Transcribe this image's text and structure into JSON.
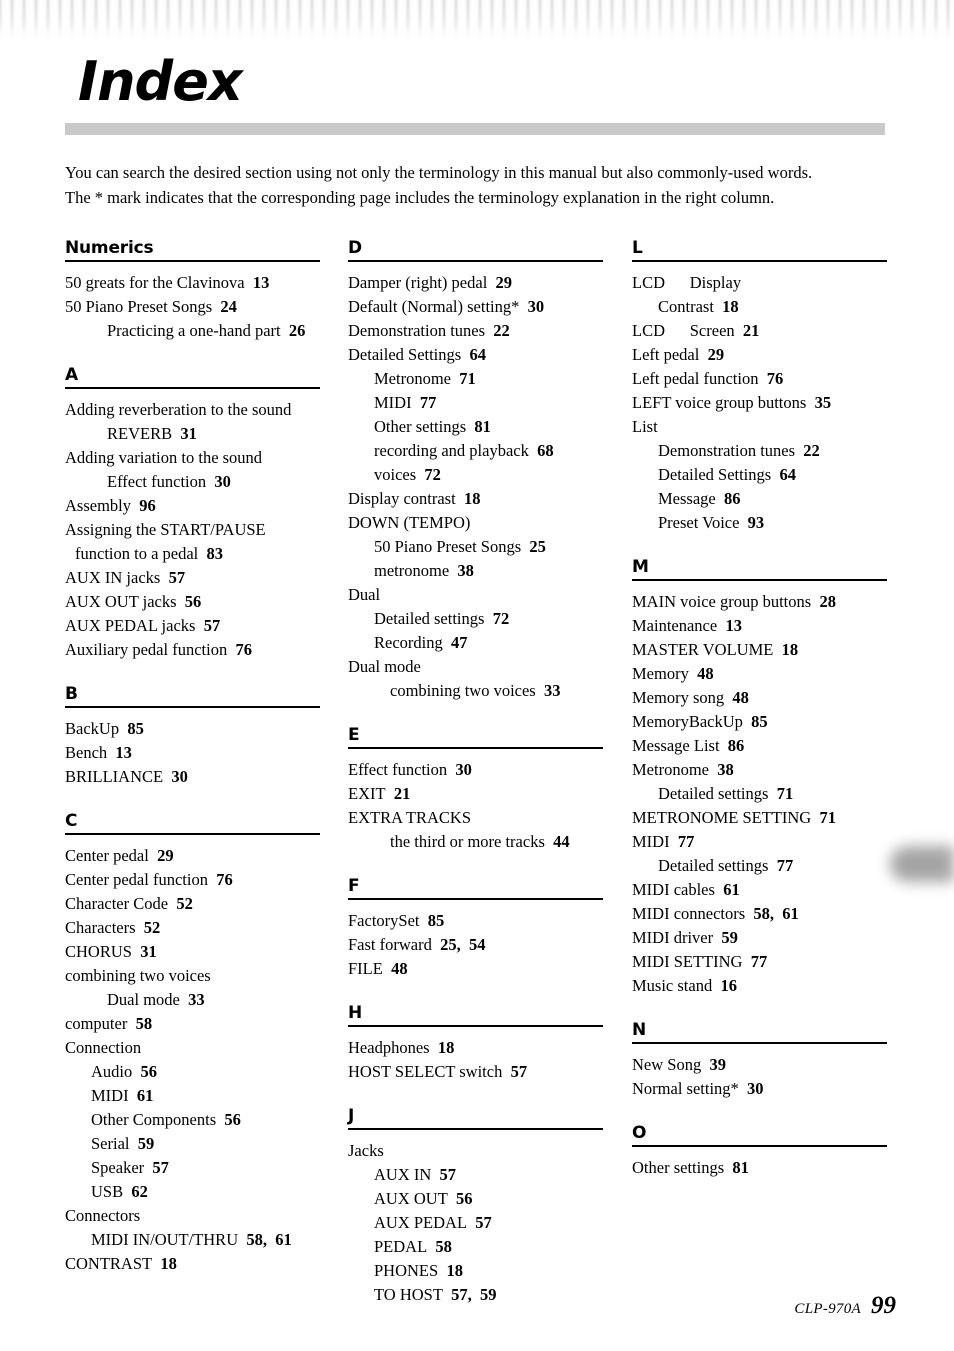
{
  "header": {
    "decoration": "piano-keyboard-band"
  },
  "title": "Index",
  "intro": {
    "line1": "You can search the desired section using not only the terminology in this manual but also commonly-used words.",
    "line2": "The * mark indicates that the corresponding page includes the terminology explanation in the right column."
  },
  "footer": {
    "model": "CLP-970A",
    "page": "99"
  },
  "columns": [
    {
      "id": "column-1",
      "sections": [
        {
          "heading": "Numerics",
          "entries": [
            {
              "level": 0,
              "text": "50 greats for the Clavinova",
              "page": "13"
            },
            {
              "level": 0,
              "text": "50 Piano Preset Songs",
              "page": "24"
            },
            {
              "level": 2,
              "text": "Practicing a one-hand part",
              "page": "26"
            }
          ]
        },
        {
          "heading": "A",
          "entries": [
            {
              "level": 0,
              "text": "Adding reverberation to the sound",
              "page": ""
            },
            {
              "level": 2,
              "text": "REVERB",
              "page": "31"
            },
            {
              "level": 0,
              "text": "Adding variation to the sound",
              "page": ""
            },
            {
              "level": 2,
              "text": "Effect function",
              "page": "30"
            },
            {
              "level": 0,
              "text": "Assembly",
              "page": "96"
            },
            {
              "level": 0,
              "text": "Assigning the START/PAUSE",
              "page": ""
            },
            {
              "level": 3,
              "text": "function to a pedal",
              "page": "83"
            },
            {
              "level": 0,
              "text": "AUX IN jacks",
              "page": "57"
            },
            {
              "level": 0,
              "text": "AUX OUT jacks",
              "page": "56"
            },
            {
              "level": 0,
              "text": "AUX PEDAL jacks",
              "page": "57"
            },
            {
              "level": 0,
              "text": "Auxiliary pedal function",
              "page": "76"
            }
          ]
        },
        {
          "heading": "B",
          "entries": [
            {
              "level": 0,
              "text": "BackUp",
              "page": "85"
            },
            {
              "level": 0,
              "text": "Bench",
              "page": "13"
            },
            {
              "level": 0,
              "text": "BRILLIANCE",
              "page": "30"
            }
          ]
        },
        {
          "heading": "C",
          "entries": [
            {
              "level": 0,
              "text": "Center pedal",
              "page": "29"
            },
            {
              "level": 0,
              "text": "Center pedal function",
              "page": "76"
            },
            {
              "level": 0,
              "text": "Character Code",
              "page": "52"
            },
            {
              "level": 0,
              "text": "Characters",
              "page": "52"
            },
            {
              "level": 0,
              "text": "CHORUS",
              "page": "31"
            },
            {
              "level": 0,
              "text": "combining two voices",
              "page": ""
            },
            {
              "level": 2,
              "text": "Dual mode",
              "page": "33"
            },
            {
              "level": 0,
              "text": "computer",
              "page": "58"
            },
            {
              "level": 0,
              "text": "Connection",
              "page": ""
            },
            {
              "level": 1,
              "text": "Audio",
              "page": "56"
            },
            {
              "level": 1,
              "text": "MIDI",
              "page": "61"
            },
            {
              "level": 1,
              "text": "Other Components",
              "page": "56"
            },
            {
              "level": 1,
              "text": "Serial",
              "page": "59"
            },
            {
              "level": 1,
              "text": "Speaker",
              "page": "57"
            },
            {
              "level": 1,
              "text": "USB",
              "page": "62"
            },
            {
              "level": 0,
              "text": "Connectors",
              "page": ""
            },
            {
              "level": 1,
              "text": "MIDI IN/OUT/THRU",
              "page": "58,  61"
            },
            {
              "level": 0,
              "text": "CONTRAST",
              "page": "18"
            }
          ]
        }
      ]
    },
    {
      "id": "column-2",
      "sections": [
        {
          "heading": "D",
          "entries": [
            {
              "level": 0,
              "text": "Damper (right) pedal",
              "page": "29"
            },
            {
              "level": 0,
              "text": "Default (Normal) setting*",
              "page": "30"
            },
            {
              "level": 0,
              "text": "Demonstration tunes",
              "page": "22"
            },
            {
              "level": 0,
              "text": "Detailed Settings",
              "page": "64"
            },
            {
              "level": 1,
              "text": "Metronome",
              "page": "71"
            },
            {
              "level": 1,
              "text": "MIDI",
              "page": "77"
            },
            {
              "level": 1,
              "text": "Other settings",
              "page": "81"
            },
            {
              "level": 1,
              "text": "recording and playback",
              "page": "68"
            },
            {
              "level": 1,
              "text": "voices",
              "page": "72"
            },
            {
              "level": 0,
              "text": "Display contrast",
              "page": "18"
            },
            {
              "level": 0,
              "text": "DOWN (TEMPO)",
              "page": ""
            },
            {
              "level": 1,
              "text": "50 Piano Preset Songs",
              "page": "25"
            },
            {
              "level": 1,
              "text": "metronome",
              "page": "38"
            },
            {
              "level": 0,
              "text": "Dual",
              "page": ""
            },
            {
              "level": 1,
              "text": "Detailed settings",
              "page": "72"
            },
            {
              "level": 1,
              "text": "Recording",
              "page": "47"
            },
            {
              "level": 0,
              "text": "Dual mode",
              "page": ""
            },
            {
              "level": 2,
              "text": "combining two voices",
              "page": "33"
            }
          ]
        },
        {
          "heading": "E",
          "entries": [
            {
              "level": 0,
              "text": "Effect function",
              "page": "30"
            },
            {
              "level": 0,
              "text": "EXIT",
              "page": "21"
            },
            {
              "level": 0,
              "text": "EXTRA TRACKS",
              "page": ""
            },
            {
              "level": 2,
              "text": "the third or more tracks",
              "page": "44"
            }
          ]
        },
        {
          "heading": "F",
          "entries": [
            {
              "level": 0,
              "text": "FactorySet",
              "page": "85"
            },
            {
              "level": 0,
              "text": "Fast forward",
              "page": "25,  54"
            },
            {
              "level": 0,
              "text": "FILE",
              "page": "48"
            }
          ]
        },
        {
          "heading": "H",
          "entries": [
            {
              "level": 0,
              "text": "Headphones",
              "page": "18"
            },
            {
              "level": 0,
              "text": "HOST SELECT switch",
              "page": "57"
            }
          ]
        },
        {
          "heading": "J",
          "entries": [
            {
              "level": 0,
              "text": "Jacks",
              "page": ""
            },
            {
              "level": 1,
              "text": "AUX IN",
              "page": "57"
            },
            {
              "level": 1,
              "text": "AUX OUT",
              "page": "56"
            },
            {
              "level": 1,
              "text": "AUX PEDAL",
              "page": "57"
            },
            {
              "level": 1,
              "text": "PEDAL",
              "page": "58"
            },
            {
              "level": 1,
              "text": "PHONES",
              "page": "18"
            },
            {
              "level": 1,
              "text": "TO HOST",
              "page": "57,  59"
            }
          ]
        }
      ]
    },
    {
      "id": "column-3",
      "sections": [
        {
          "heading": "L",
          "entries": [
            {
              "level": 0,
              "text": "LCD      Display",
              "page": ""
            },
            {
              "level": 1,
              "text": "Contrast",
              "page": "18"
            },
            {
              "level": 0,
              "text": "LCD      Screen",
              "page": "21"
            },
            {
              "level": 0,
              "text": "Left pedal",
              "page": "29"
            },
            {
              "level": 0,
              "text": "Left pedal function",
              "page": "76"
            },
            {
              "level": 0,
              "text": "LEFT voice group buttons",
              "page": "35"
            },
            {
              "level": 0,
              "text": "List",
              "page": ""
            },
            {
              "level": 1,
              "text": "Demonstration tunes",
              "page": "22"
            },
            {
              "level": 1,
              "text": "Detailed Settings",
              "page": "64"
            },
            {
              "level": 1,
              "text": "Message",
              "page": "86"
            },
            {
              "level": 1,
              "text": "Preset Voice",
              "page": "93"
            }
          ]
        },
        {
          "heading": "M",
          "entries": [
            {
              "level": 0,
              "text": "MAIN voice group buttons",
              "page": "28"
            },
            {
              "level": 0,
              "text": "Maintenance",
              "page": "13"
            },
            {
              "level": 0,
              "text": "MASTER VOLUME",
              "page": "18"
            },
            {
              "level": 0,
              "text": "Memory",
              "page": "48"
            },
            {
              "level": 0,
              "text": "Memory song",
              "page": "48"
            },
            {
              "level": 0,
              "text": "MemoryBackUp",
              "page": "85"
            },
            {
              "level": 0,
              "text": "Message List",
              "page": "86"
            },
            {
              "level": 0,
              "text": "Metronome",
              "page": "38"
            },
            {
              "level": 1,
              "text": "Detailed settings",
              "page": "71"
            },
            {
              "level": 0,
              "text": "METRONOME SETTING",
              "page": "71"
            },
            {
              "level": 0,
              "text": "MIDI",
              "page": "77"
            },
            {
              "level": 1,
              "text": "Detailed settings",
              "page": "77"
            },
            {
              "level": 0,
              "text": "MIDI cables",
              "page": "61"
            },
            {
              "level": 0,
              "text": "MIDI connectors",
              "page": "58,  61"
            },
            {
              "level": 0,
              "text": "MIDI driver",
              "page": "59"
            },
            {
              "level": 0,
              "text": "MIDI SETTING",
              "page": "77"
            },
            {
              "level": 0,
              "text": "Music stand",
              "page": "16"
            }
          ]
        },
        {
          "heading": "N",
          "entries": [
            {
              "level": 0,
              "text": "New Song",
              "page": "39"
            },
            {
              "level": 0,
              "text": "Normal setting*",
              "page": "30"
            }
          ]
        },
        {
          "heading": "O",
          "entries": [
            {
              "level": 0,
              "text": "Other settings",
              "page": "81"
            }
          ]
        }
      ]
    }
  ]
}
